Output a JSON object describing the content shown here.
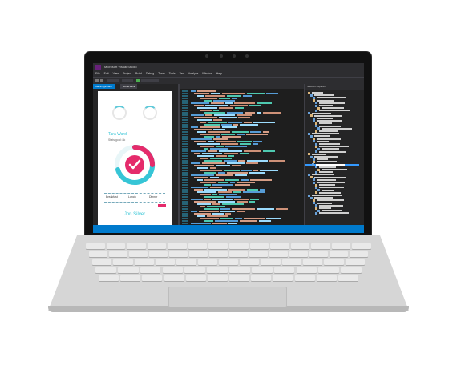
{
  "window": {
    "title": "Microsoft Visual Studio"
  },
  "menu": [
    "File",
    "Edit",
    "View",
    "Project",
    "Build",
    "Debug",
    "Team",
    "Tools",
    "Test",
    "Analyze",
    "Window",
    "Help"
  ],
  "designer": {
    "tabs": [
      "MainPage.xaml",
      "Home.xaml"
    ],
    "user_name": "Tara Ward",
    "user_sub": "Stats goal: 8k",
    "field_left": "Breakfast",
    "field_mid": "Lunch",
    "field_right": "Dinner",
    "footer_name": "Jon Silver"
  },
  "code": {
    "tab": "MainPage.xaml"
  },
  "solution_explorer": {
    "title": "Solution Explorer"
  },
  "colors": {
    "accent_blue": "#007acc",
    "ring_cyan": "#36c5d6",
    "ring_pink": "#e52b6b",
    "vs_purple": "#68217a"
  },
  "icons": [
    "visual-studio-logo",
    "heart-icon",
    "camera"
  ]
}
